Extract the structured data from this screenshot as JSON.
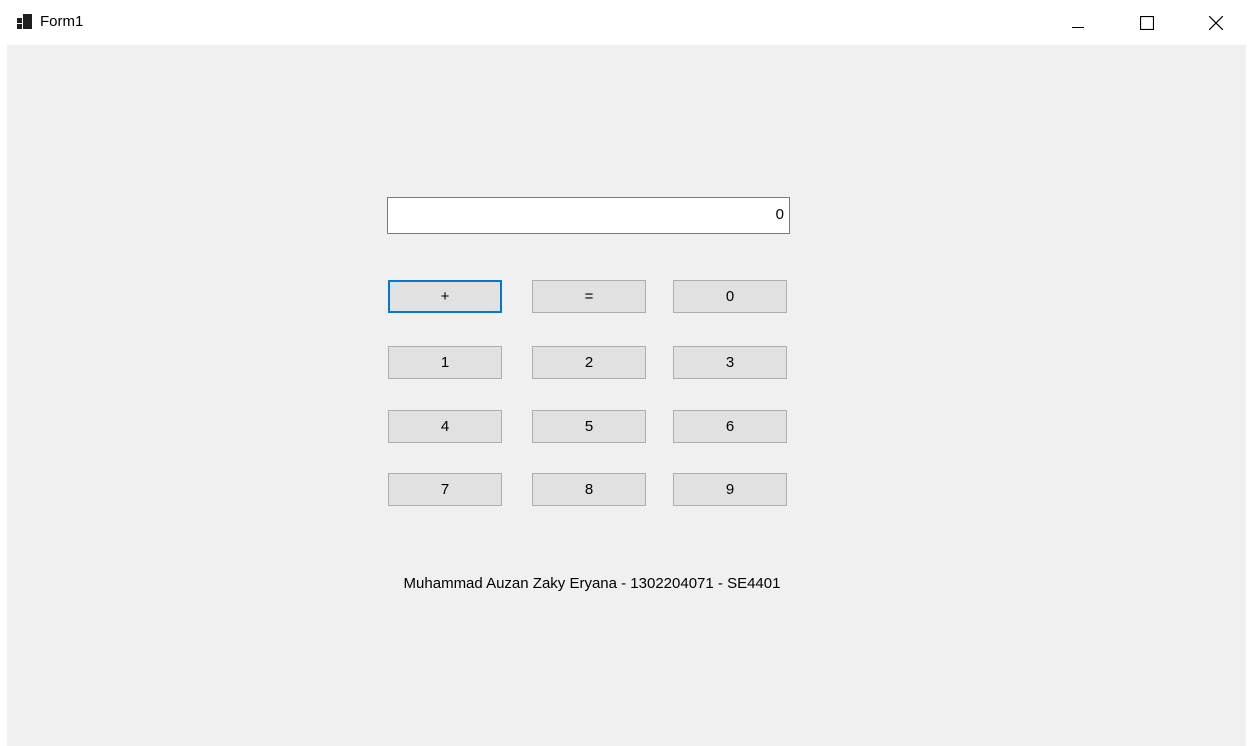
{
  "window": {
    "title": "Form1",
    "icon": "form-app-icon",
    "controls": [
      "minimize-icon",
      "maximize-icon",
      "close-icon"
    ]
  },
  "display": {
    "value": "0"
  },
  "buttons": {
    "plus": "+",
    "equals": "=",
    "d0": "0",
    "d1": "1",
    "d2": "2",
    "d3": "3",
    "d4": "4",
    "d5": "5",
    "d6": "6",
    "d7": "7",
    "d8": "8",
    "d9": "9"
  },
  "focused_button": "plus",
  "footer": {
    "text": "Muhammad Auzan Zaky Eryana - 1302204071 - SE4401"
  },
  "colors": {
    "focus": "#0078d7",
    "button": "#e1e1e1",
    "background": "#f0f0f0"
  }
}
